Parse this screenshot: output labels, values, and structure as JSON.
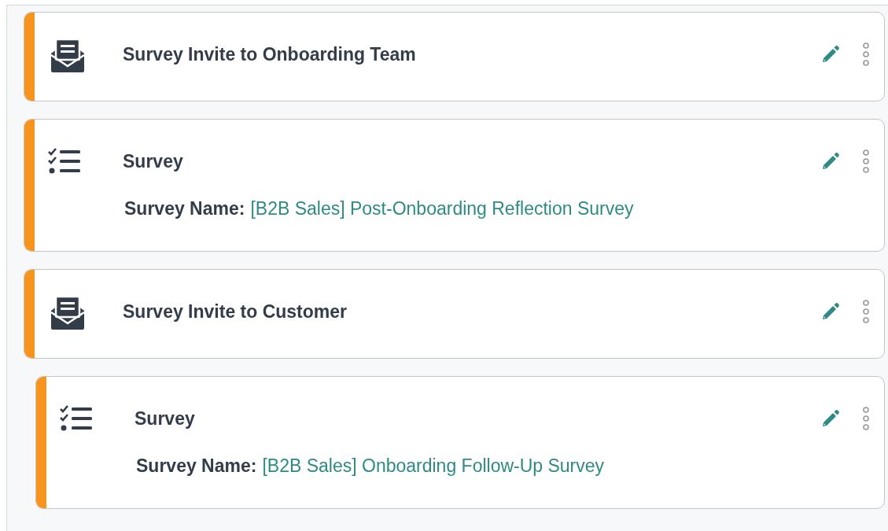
{
  "steps": [
    {
      "kind": "invite",
      "title": "Survey Invite to Onboarding Team"
    },
    {
      "kind": "survey",
      "title": "Survey",
      "detail_label": "Survey Name:",
      "detail_value": "[B2B Sales] Post-Onboarding Reflection Survey"
    },
    {
      "kind": "invite",
      "title": "Survey Invite to Customer",
      "children": [
        {
          "kind": "survey",
          "title": "Survey",
          "detail_label": "Survey Name:",
          "detail_value": "[B2B Sales] Onboarding Follow-Up Survey"
        }
      ]
    }
  ]
}
